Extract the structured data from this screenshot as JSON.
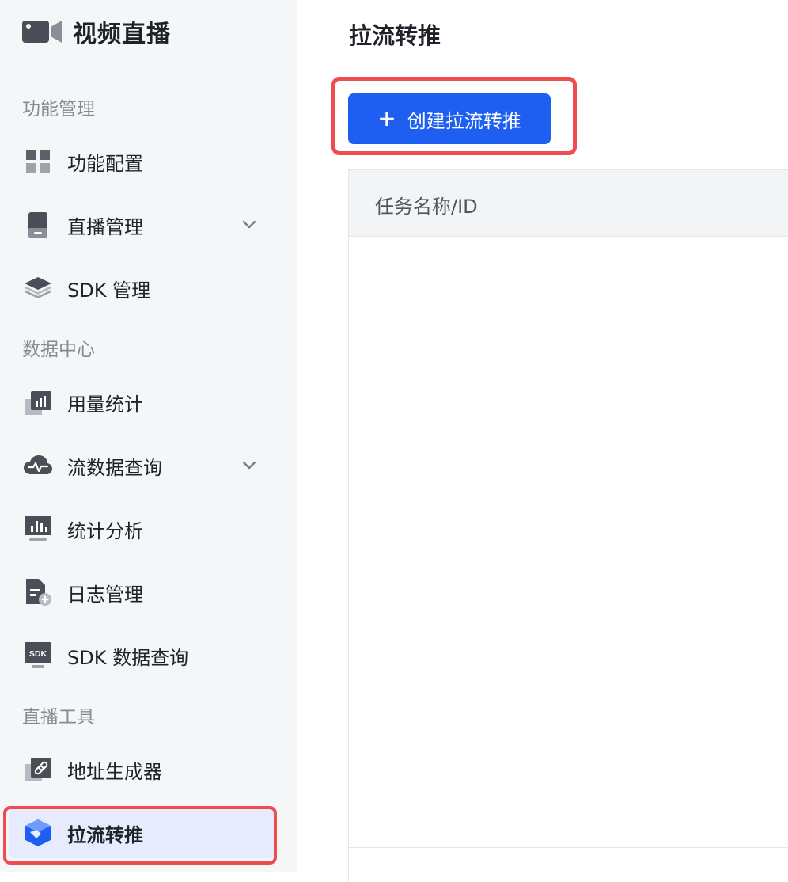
{
  "brand": {
    "title": "视频直播",
    "icon": "video-camera-icon"
  },
  "sidebar": {
    "sections": [
      {
        "label": "功能管理"
      },
      {
        "label": "数据中心"
      },
      {
        "label": "直播工具"
      }
    ],
    "items": [
      {
        "label": "功能配置",
        "icon": "grid-icon"
      },
      {
        "label": "直播管理",
        "icon": "device-icon",
        "expandable": true
      },
      {
        "label": "SDK 管理",
        "icon": "layers-icon"
      },
      {
        "label": "用量统计",
        "icon": "bar-chart-icon"
      },
      {
        "label": "流数据查询",
        "icon": "cloud-pulse-icon",
        "expandable": true
      },
      {
        "label": "统计分析",
        "icon": "monitor-chart-icon"
      },
      {
        "label": "日志管理",
        "icon": "document-plus-icon"
      },
      {
        "label": "SDK 数据查询",
        "icon": "sdk-icon",
        "icon_text": "SDK"
      },
      {
        "label": "地址生成器",
        "icon": "link-icon"
      },
      {
        "label": "拉流转推",
        "icon": "cube-icon",
        "active": true
      }
    ]
  },
  "main": {
    "title": "拉流转推",
    "create_button": {
      "icon": "+",
      "label": "创建拉流转推"
    },
    "table": {
      "columns": [
        "任务名称/ID"
      ],
      "rows": []
    }
  },
  "colors": {
    "accent": "#1e5ef0",
    "active_bg": "#e6ebfd",
    "highlight": "#f04b4f",
    "sidebar_bg": "#f5f6f8"
  }
}
